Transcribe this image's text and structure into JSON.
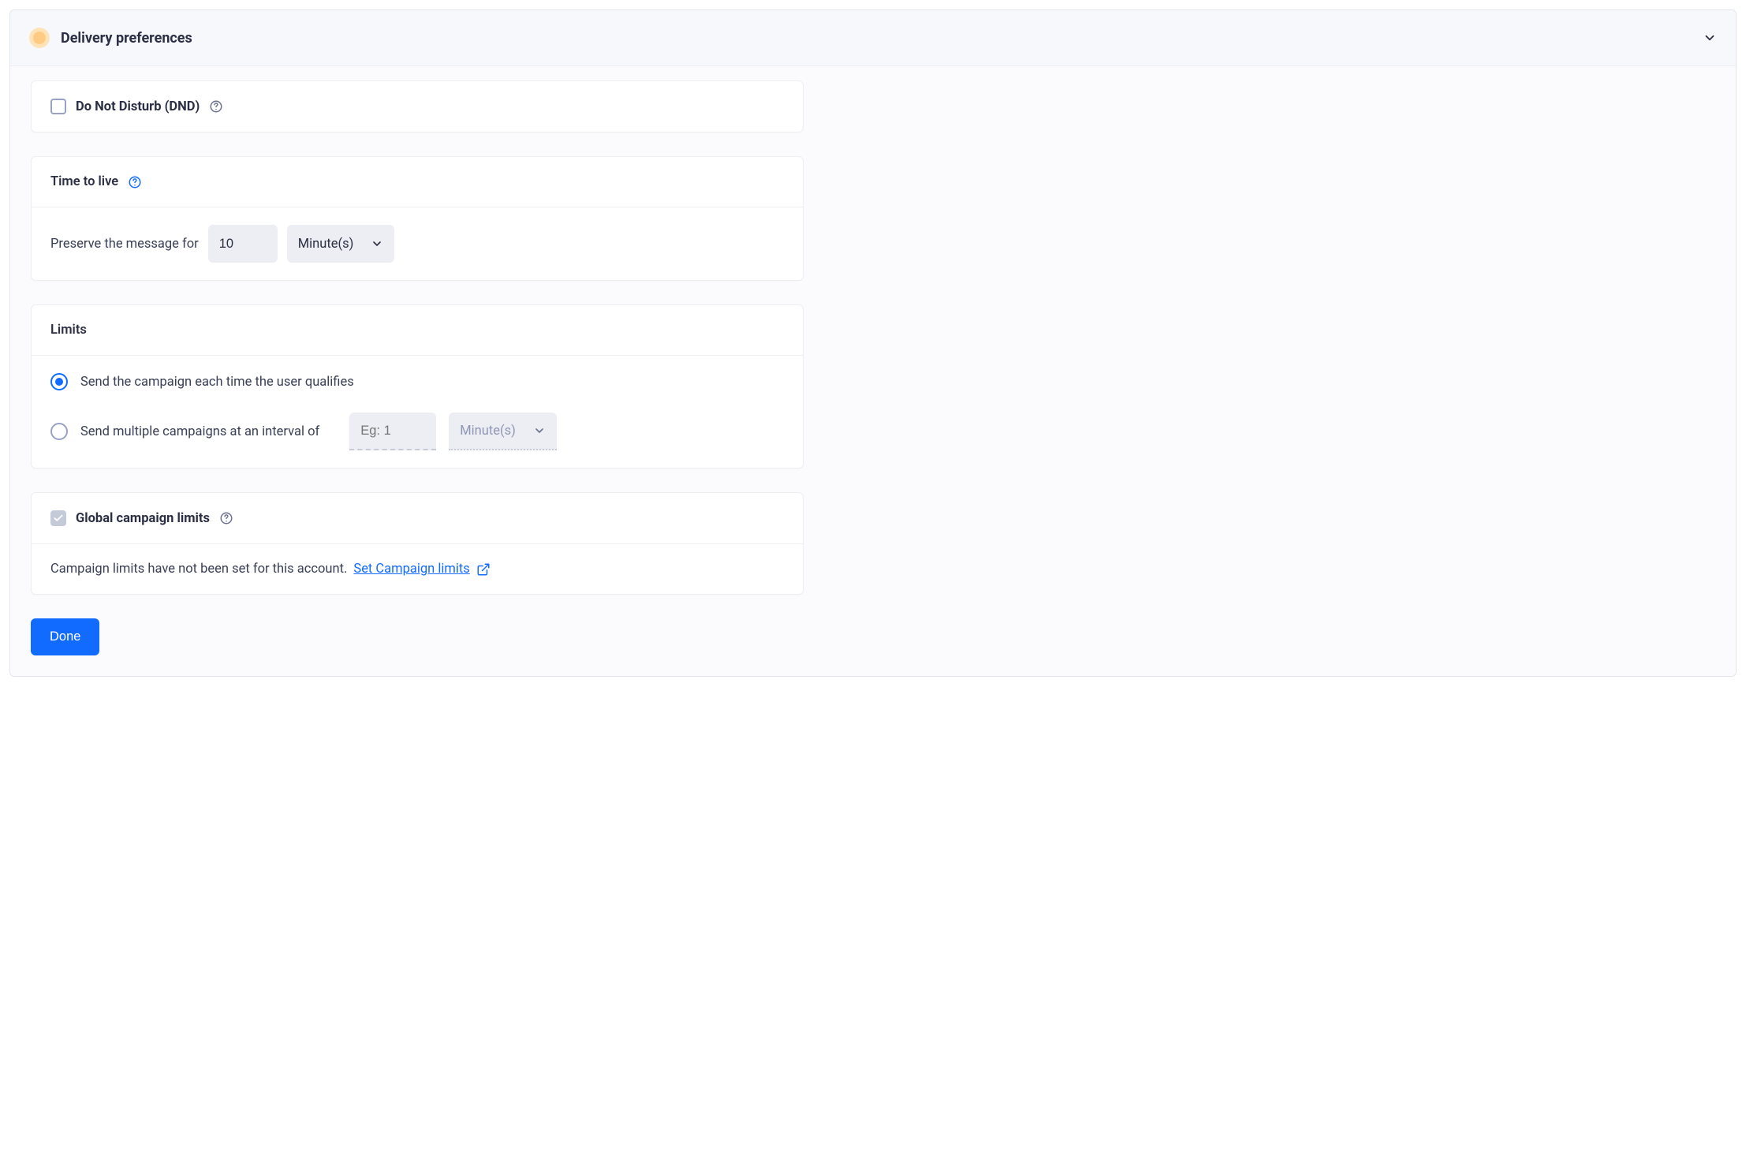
{
  "header": {
    "title": "Delivery preferences"
  },
  "dnd": {
    "label": "Do Not Disturb (DND)",
    "checked": false
  },
  "ttl": {
    "title": "Time to live",
    "preserve_label": "Preserve the message for",
    "value": "10",
    "unit": "Minute(s)"
  },
  "limits": {
    "title": "Limits",
    "options": [
      {
        "label": "Send the campaign each time the user qualifies",
        "selected": true
      },
      {
        "label": "Send multiple campaigns at an interval of",
        "selected": false
      }
    ],
    "interval_placeholder": "Eg: 1",
    "interval_unit": "Minute(s)"
  },
  "global_limits": {
    "label": "Global campaign limits",
    "checked": true,
    "message": "Campaign limits have not been set for this account.",
    "link_text": "Set Campaign limits "
  },
  "actions": {
    "done": "Done"
  }
}
